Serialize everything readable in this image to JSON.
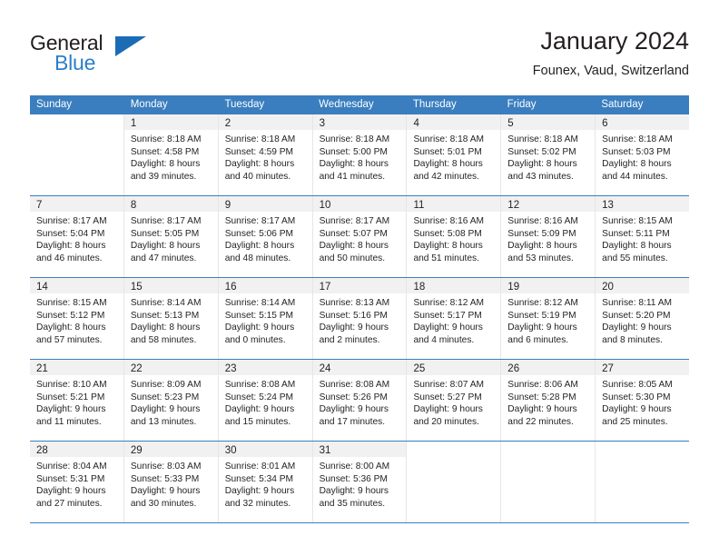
{
  "brand": {
    "word_one": "General",
    "word_two": "Blue",
    "triangle_icon": "brand-triangle-icon",
    "primary_color": "#1b6cb5",
    "text_color": "#231f20"
  },
  "header": {
    "title": "January 2024",
    "subtitle": "Founex, Vaud, Switzerland"
  },
  "calendar": {
    "header_bg": "#3a7ebf",
    "daynum_bg": "#f1f1f1",
    "weekday_labels": [
      "Sunday",
      "Monday",
      "Tuesday",
      "Wednesday",
      "Thursday",
      "Friday",
      "Saturday"
    ],
    "weeks": [
      [
        {
          "day": "",
          "lines": []
        },
        {
          "day": "1",
          "lines": [
            "Sunrise: 8:18 AM",
            "Sunset: 4:58 PM",
            "Daylight: 8 hours",
            "and 39 minutes."
          ]
        },
        {
          "day": "2",
          "lines": [
            "Sunrise: 8:18 AM",
            "Sunset: 4:59 PM",
            "Daylight: 8 hours",
            "and 40 minutes."
          ]
        },
        {
          "day": "3",
          "lines": [
            "Sunrise: 8:18 AM",
            "Sunset: 5:00 PM",
            "Daylight: 8 hours",
            "and 41 minutes."
          ]
        },
        {
          "day": "4",
          "lines": [
            "Sunrise: 8:18 AM",
            "Sunset: 5:01 PM",
            "Daylight: 8 hours",
            "and 42 minutes."
          ]
        },
        {
          "day": "5",
          "lines": [
            "Sunrise: 8:18 AM",
            "Sunset: 5:02 PM",
            "Daylight: 8 hours",
            "and 43 minutes."
          ]
        },
        {
          "day": "6",
          "lines": [
            "Sunrise: 8:18 AM",
            "Sunset: 5:03 PM",
            "Daylight: 8 hours",
            "and 44 minutes."
          ]
        }
      ],
      [
        {
          "day": "7",
          "lines": [
            "Sunrise: 8:17 AM",
            "Sunset: 5:04 PM",
            "Daylight: 8 hours",
            "and 46 minutes."
          ]
        },
        {
          "day": "8",
          "lines": [
            "Sunrise: 8:17 AM",
            "Sunset: 5:05 PM",
            "Daylight: 8 hours",
            "and 47 minutes."
          ]
        },
        {
          "day": "9",
          "lines": [
            "Sunrise: 8:17 AM",
            "Sunset: 5:06 PM",
            "Daylight: 8 hours",
            "and 48 minutes."
          ]
        },
        {
          "day": "10",
          "lines": [
            "Sunrise: 8:17 AM",
            "Sunset: 5:07 PM",
            "Daylight: 8 hours",
            "and 50 minutes."
          ]
        },
        {
          "day": "11",
          "lines": [
            "Sunrise: 8:16 AM",
            "Sunset: 5:08 PM",
            "Daylight: 8 hours",
            "and 51 minutes."
          ]
        },
        {
          "day": "12",
          "lines": [
            "Sunrise: 8:16 AM",
            "Sunset: 5:09 PM",
            "Daylight: 8 hours",
            "and 53 minutes."
          ]
        },
        {
          "day": "13",
          "lines": [
            "Sunrise: 8:15 AM",
            "Sunset: 5:11 PM",
            "Daylight: 8 hours",
            "and 55 minutes."
          ]
        }
      ],
      [
        {
          "day": "14",
          "lines": [
            "Sunrise: 8:15 AM",
            "Sunset: 5:12 PM",
            "Daylight: 8 hours",
            "and 57 minutes."
          ]
        },
        {
          "day": "15",
          "lines": [
            "Sunrise: 8:14 AM",
            "Sunset: 5:13 PM",
            "Daylight: 8 hours",
            "and 58 minutes."
          ]
        },
        {
          "day": "16",
          "lines": [
            "Sunrise: 8:14 AM",
            "Sunset: 5:15 PM",
            "Daylight: 9 hours",
            "and 0 minutes."
          ]
        },
        {
          "day": "17",
          "lines": [
            "Sunrise: 8:13 AM",
            "Sunset: 5:16 PM",
            "Daylight: 9 hours",
            "and 2 minutes."
          ]
        },
        {
          "day": "18",
          "lines": [
            "Sunrise: 8:12 AM",
            "Sunset: 5:17 PM",
            "Daylight: 9 hours",
            "and 4 minutes."
          ]
        },
        {
          "day": "19",
          "lines": [
            "Sunrise: 8:12 AM",
            "Sunset: 5:19 PM",
            "Daylight: 9 hours",
            "and 6 minutes."
          ]
        },
        {
          "day": "20",
          "lines": [
            "Sunrise: 8:11 AM",
            "Sunset: 5:20 PM",
            "Daylight: 9 hours",
            "and 8 minutes."
          ]
        }
      ],
      [
        {
          "day": "21",
          "lines": [
            "Sunrise: 8:10 AM",
            "Sunset: 5:21 PM",
            "Daylight: 9 hours",
            "and 11 minutes."
          ]
        },
        {
          "day": "22",
          "lines": [
            "Sunrise: 8:09 AM",
            "Sunset: 5:23 PM",
            "Daylight: 9 hours",
            "and 13 minutes."
          ]
        },
        {
          "day": "23",
          "lines": [
            "Sunrise: 8:08 AM",
            "Sunset: 5:24 PM",
            "Daylight: 9 hours",
            "and 15 minutes."
          ]
        },
        {
          "day": "24",
          "lines": [
            "Sunrise: 8:08 AM",
            "Sunset: 5:26 PM",
            "Daylight: 9 hours",
            "and 17 minutes."
          ]
        },
        {
          "day": "25",
          "lines": [
            "Sunrise: 8:07 AM",
            "Sunset: 5:27 PM",
            "Daylight: 9 hours",
            "and 20 minutes."
          ]
        },
        {
          "day": "26",
          "lines": [
            "Sunrise: 8:06 AM",
            "Sunset: 5:28 PM",
            "Daylight: 9 hours",
            "and 22 minutes."
          ]
        },
        {
          "day": "27",
          "lines": [
            "Sunrise: 8:05 AM",
            "Sunset: 5:30 PM",
            "Daylight: 9 hours",
            "and 25 minutes."
          ]
        }
      ],
      [
        {
          "day": "28",
          "lines": [
            "Sunrise: 8:04 AM",
            "Sunset: 5:31 PM",
            "Daylight: 9 hours",
            "and 27 minutes."
          ]
        },
        {
          "day": "29",
          "lines": [
            "Sunrise: 8:03 AM",
            "Sunset: 5:33 PM",
            "Daylight: 9 hours",
            "and 30 minutes."
          ]
        },
        {
          "day": "30",
          "lines": [
            "Sunrise: 8:01 AM",
            "Sunset: 5:34 PM",
            "Daylight: 9 hours",
            "and 32 minutes."
          ]
        },
        {
          "day": "31",
          "lines": [
            "Sunrise: 8:00 AM",
            "Sunset: 5:36 PM",
            "Daylight: 9 hours",
            "and 35 minutes."
          ]
        },
        {
          "day": "",
          "lines": []
        },
        {
          "day": "",
          "lines": []
        },
        {
          "day": "",
          "lines": []
        }
      ]
    ]
  }
}
